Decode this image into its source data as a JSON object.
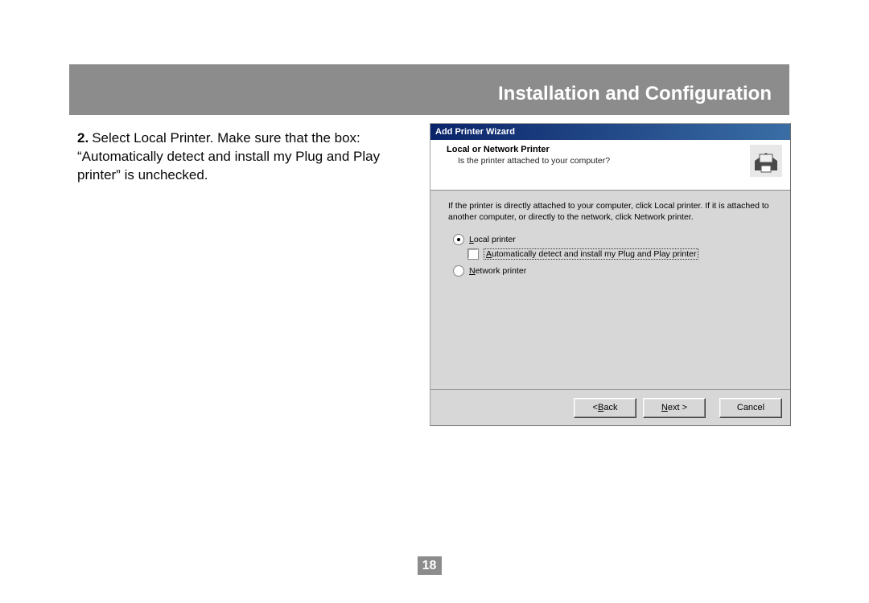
{
  "header": {
    "title": "Installation and Configuration"
  },
  "instruction": {
    "num": "2.",
    "text": "Select Local Printer.  Make sure that the box: “Automatically detect and install my Plug and Play printer” is unchecked."
  },
  "dialog": {
    "title": "Add Printer Wizard",
    "subheader": {
      "title": "Local or Network Printer",
      "question": "Is the printer attached to your computer?"
    },
    "desc": "If the printer is directly attached to your computer, click Local printer.  If it is attached to another computer, or directly to the network, click Network printer.",
    "options": {
      "local_prefix": "L",
      "local_rest": "ocal printer",
      "auto_prefix": "A",
      "auto_rest": "utomatically detect and install my Plug and Play printer",
      "net_prefix": "N",
      "net_rest": "etwork printer"
    },
    "buttons": {
      "back_pre": "< ",
      "back_u": "B",
      "back_post": "ack",
      "next_u": "N",
      "next_post": "ext >",
      "cancel": "Cancel"
    }
  },
  "page_number": "18"
}
